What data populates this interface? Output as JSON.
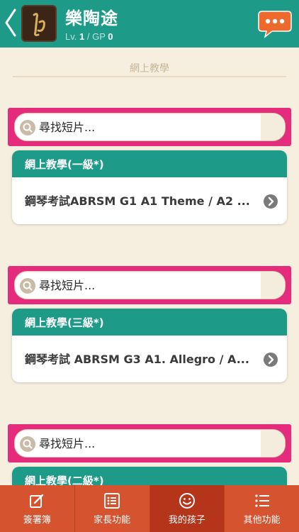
{
  "header": {
    "title": "樂陶途",
    "level_label": "Lv.",
    "level_value": "1",
    "gp_label": "/ GP",
    "gp_value": "0"
  },
  "section": {
    "title": "網上教學"
  },
  "blocks": [
    {
      "search_placeholder": "尋找短片...",
      "category": "網上教學(一級*)",
      "video_title": "鋼琴考試ABRSM G1 A1 Theme / A2 ..."
    },
    {
      "search_placeholder": "尋找短片...",
      "category": "網上教學(三級*)",
      "video_title": "鋼琴考試 ABRSM G3 A1. Allegro / A..."
    },
    {
      "search_placeholder": "尋找短片...",
      "category": "網上教學(二級*)",
      "video_title": ""
    }
  ],
  "tabbar": {
    "items": [
      {
        "label": "簽署簿",
        "icon": "edit-icon"
      },
      {
        "label": "家長功能",
        "icon": "list-icon"
      },
      {
        "label": "我的孩子",
        "icon": "smile-icon"
      },
      {
        "label": "其他功能",
        "icon": "menu-icon"
      }
    ],
    "active_index": 2
  },
  "colors": {
    "header": "#1e9a89",
    "search_frame": "#e52b7c",
    "tabbar": "#d65330",
    "chat_button": "#ee6a2c"
  }
}
